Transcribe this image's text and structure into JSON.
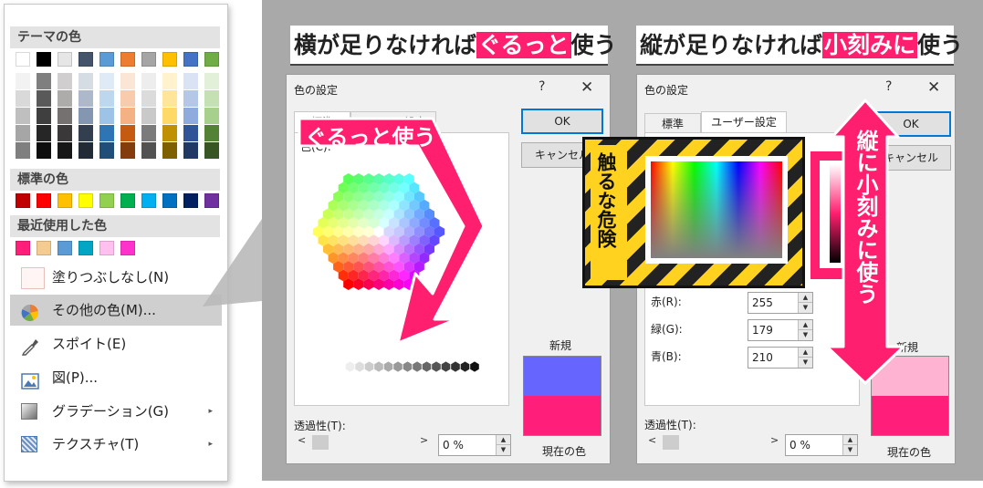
{
  "menu": {
    "theme_heading": "テーマの色",
    "standard_heading": "標準の色",
    "recent_heading": "最近使用した色",
    "theme_top": [
      "#ffffff",
      "#000000",
      "#e7e6e6",
      "#44546a",
      "#5b9bd5",
      "#ed7d31",
      "#a5a5a5",
      "#ffc000",
      "#4472c4",
      "#70ad47"
    ],
    "theme_shades": [
      [
        "#f2f2f2",
        "#d9d9d9",
        "#bfbfbf",
        "#a6a6a6",
        "#7f7f7f"
      ],
      [
        "#7f7f7f",
        "#595959",
        "#3f3f3f",
        "#262626",
        "#0d0d0d"
      ],
      [
        "#d0cece",
        "#aeabab",
        "#757171",
        "#3a3838",
        "#161616"
      ],
      [
        "#d6dce4",
        "#adb9ca",
        "#8497b0",
        "#333f4f",
        "#222a35"
      ],
      [
        "#deebf6",
        "#bdd7ee",
        "#9dc3e6",
        "#2e75b5",
        "#1f4e79"
      ],
      [
        "#fbe5d5",
        "#f7cbac",
        "#f4b183",
        "#c55a11",
        "#833c0b"
      ],
      [
        "#ededed",
        "#dbdbdb",
        "#c9c9c9",
        "#7b7b7b",
        "#525252"
      ],
      [
        "#fff2cc",
        "#fee599",
        "#ffd965",
        "#bf9000",
        "#7f6000"
      ],
      [
        "#dae3f3",
        "#b4c7e7",
        "#8faadc",
        "#2f5597",
        "#203864"
      ],
      [
        "#e2efd9",
        "#c5e0b3",
        "#a8d08d",
        "#538135",
        "#375623"
      ]
    ],
    "standard": [
      "#c00000",
      "#ff0000",
      "#ffc000",
      "#ffff00",
      "#92d050",
      "#00b050",
      "#00b0f0",
      "#0070c0",
      "#002060",
      "#7030a0"
    ],
    "recent": [
      "#ff1f7a",
      "#f4cb90",
      "#5b9bd5",
      "#00a6c4",
      "#ffc0f0",
      "#ff33cc"
    ],
    "items": {
      "no_fill": "塗りつぶしなし(N)",
      "more_colors": "その他の色(M)...",
      "eyedropper": "スポイト(E)",
      "picture": "図(P)...",
      "gradient": "グラデーション(G)",
      "texture": "テクスチャ(T)"
    },
    "submenu_arrow": "▸"
  },
  "left_title": {
    "pre": "横が足りなければ",
    "hl": "ぐるっと",
    "post": "使う"
  },
  "right_title": {
    "pre": "縦が足りなければ",
    "hl": "小刻みに",
    "post": "使う"
  },
  "dialog_common": {
    "title": "色の設定",
    "help": "?",
    "close": "✕",
    "ok": "OK",
    "cancel": "キャンセル",
    "transparency_label": "透過性(T):",
    "transparency_value": "0 %",
    "new_label": "新規",
    "current_label": "現在の色",
    "left_arrow": "<",
    "right_arrow": ">",
    "tab_standard": "標準",
    "tab_custom": "ユーザー設定"
  },
  "left_dialog": {
    "tab_custom_partial": "ユーザー設定",
    "colors_label_partial": "色(C):",
    "new_color": "#6666ff",
    "current_color": "#ff1f7a"
  },
  "right_dialog": {
    "red_label": "赤(R):",
    "green_label": "緑(G):",
    "blue_label": "青(B):",
    "red": "255",
    "green": "179",
    "blue": "210",
    "new_color": "#ffb3d2",
    "current_color": "#ff1f7a"
  },
  "overlays": {
    "guru_text": "ぐるっと使う",
    "danger_text": "触るな危険",
    "kizami_text": "縦に小刻みに使う"
  },
  "colors": {
    "accent_pink": "#ff1f6e",
    "warning_yellow": "#ffd21f"
  }
}
